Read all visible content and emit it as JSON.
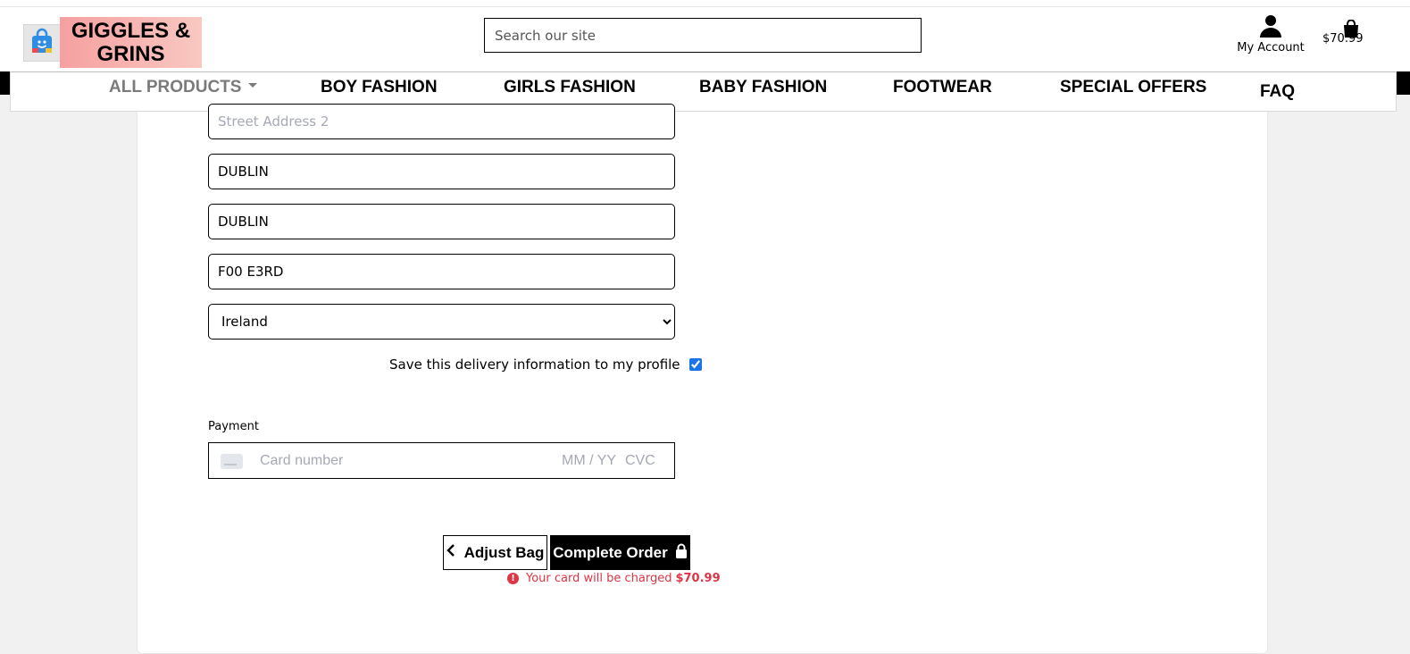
{
  "colors": {
    "accent": "#000000",
    "logo_gradient_start": "#f6a0a0",
    "logo_gradient_end": "#f9c8c1",
    "error": "#dc3545",
    "placeholder": "#a6a9b6"
  },
  "header": {
    "logo_line1": "GIGGLES &",
    "logo_line2": "GRINS",
    "logo_icon": "shopping-bag-icon",
    "search_placeholder": "Search our site",
    "account_label": "My Account",
    "account_icon": "user-icon",
    "bag_icon": "shopping-bag-icon",
    "bag_total": "$70.99"
  },
  "nav": {
    "items": [
      {
        "label": "ALL PRODUCTS"
      },
      {
        "label": "BOY FASHION"
      },
      {
        "label": "GIRLS FASHION"
      },
      {
        "label": "BABY FASHION"
      },
      {
        "label": "FOOTWEAR"
      },
      {
        "label": "SPECIAL OFFERS"
      },
      {
        "label": "FAQ"
      }
    ]
  },
  "form": {
    "street2_placeholder": "Street Address 2",
    "town_value": "DUBLIN",
    "county_value": "DUBLIN",
    "postcode_value": "F00 E3RD",
    "country_selected": "Ireland",
    "save_info_label": "Save this delivery information to my profile",
    "save_info_checked": true
  },
  "payment": {
    "label": "Payment",
    "card_placeholder": "Card number",
    "expiry_placeholder": "MM / YY",
    "cvc_placeholder": "CVC"
  },
  "actions": {
    "adjust_label": "Adjust Bag",
    "complete_label": "Complete Order",
    "charge_text": "Your card will be charged",
    "charge_amount": "$70.99"
  }
}
